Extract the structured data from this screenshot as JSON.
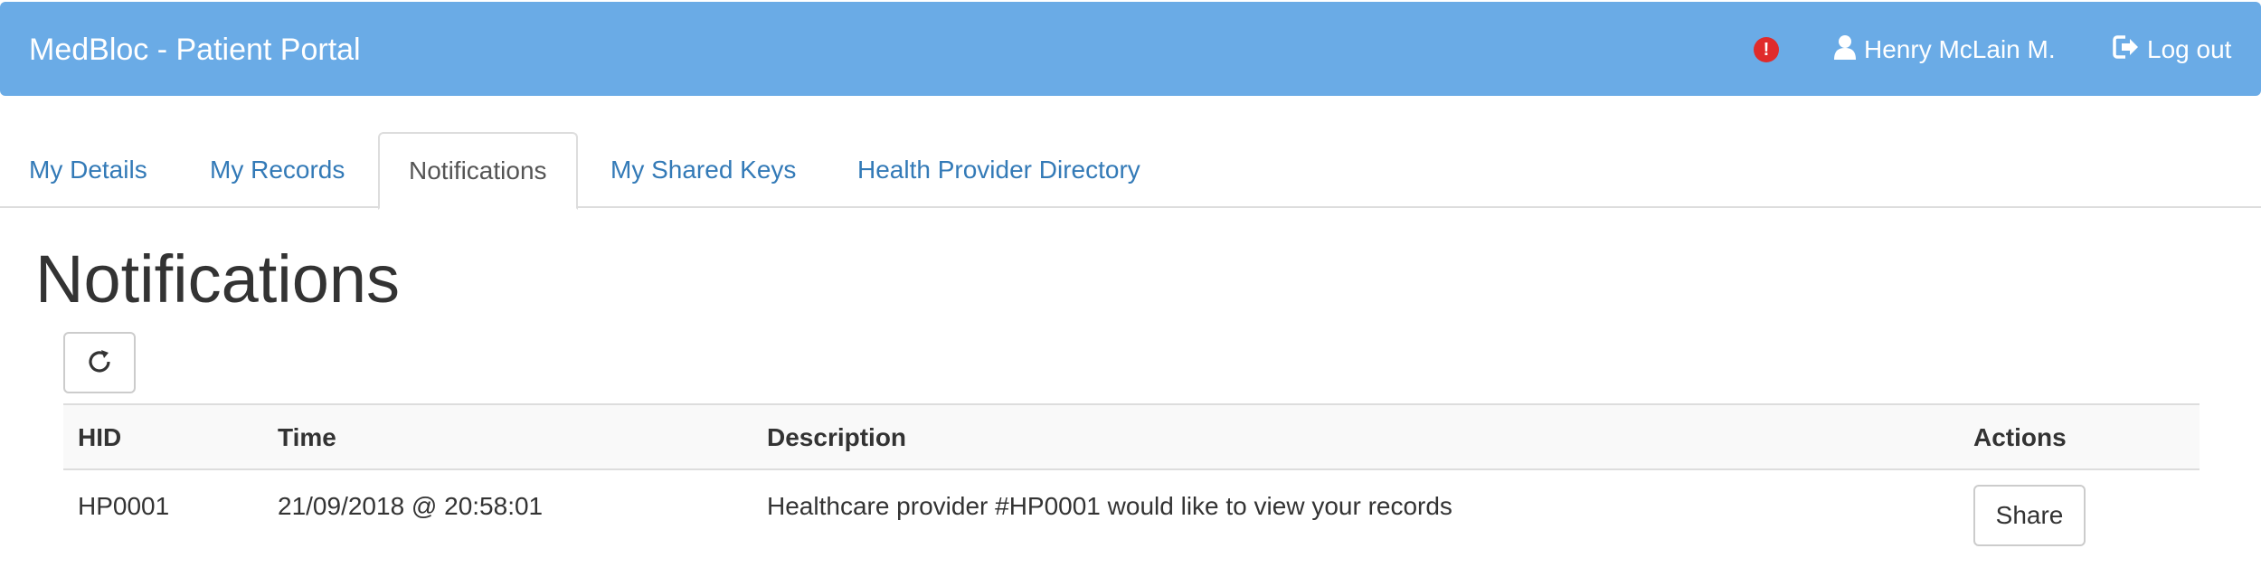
{
  "navbar": {
    "brand": "MedBloc - Patient Portal",
    "alert_icon": "exclamation-circle-icon",
    "alert_symbol": "!",
    "user_icon": "user-icon",
    "user_name": "Henry McLain M.",
    "logout_icon": "log-out-icon",
    "logout_label": "Log out",
    "background_color": "#6aabe6"
  },
  "tabs": [
    {
      "label": "My Details",
      "active": false
    },
    {
      "label": "My Records",
      "active": false
    },
    {
      "label": "Notifications",
      "active": true
    },
    {
      "label": "My Shared Keys",
      "active": false
    },
    {
      "label": "Health Provider Directory",
      "active": false
    }
  ],
  "main": {
    "title": "Notifications",
    "refresh_icon": "refresh-icon"
  },
  "table": {
    "headers": {
      "hid": "HID",
      "time": "Time",
      "description": "Description",
      "actions": "Actions"
    },
    "rows": [
      {
        "hid": "HP0001",
        "time": "21/09/2018 @ 20:58:01",
        "description": "Healthcare provider #HP0001 would like to view your records",
        "action_label": "Share"
      }
    ]
  },
  "colors": {
    "link": "#337ab7",
    "alert": "#e02b2b",
    "border": "#dddddd"
  }
}
